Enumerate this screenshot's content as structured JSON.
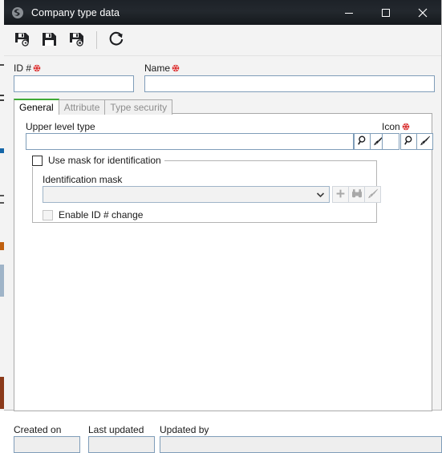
{
  "window": {
    "title": "Company type data",
    "app_icon": "globe-icon",
    "controls": {
      "minimize": "minimize-icon",
      "maximize": "maximize-icon",
      "close": "close-icon"
    }
  },
  "toolbar": {
    "buttons": [
      {
        "name": "save-and-new-button",
        "icon": "save-new-icon"
      },
      {
        "name": "save-button",
        "icon": "save-icon"
      },
      {
        "name": "save-and-close-button",
        "icon": "save-close-icon"
      },
      {
        "name": "refresh-button",
        "icon": "refresh-icon"
      }
    ]
  },
  "form": {
    "id": {
      "label": "ID #",
      "required": true,
      "value": "",
      "placeholder": ""
    },
    "name": {
      "label": "Name",
      "required": true,
      "value": "",
      "placeholder": ""
    }
  },
  "tabs": [
    {
      "label": "General",
      "active": true
    },
    {
      "label": "Attribute",
      "active": false
    },
    {
      "label": "Type security",
      "active": false
    }
  ],
  "general": {
    "upper_level_type": {
      "label": "Upper level type",
      "value": "",
      "placeholder": "",
      "search_icon": "magnifier-icon",
      "clear_icon": "brush-icon"
    },
    "icon": {
      "label": "Icon",
      "required": true,
      "value": "",
      "placeholder": "",
      "search_icon": "magnifier-icon",
      "clear_icon": "brush-icon"
    },
    "use_mask": {
      "label": "Use mask for identification",
      "checked": false,
      "enabled": true
    },
    "identification_mask": {
      "label": "Identification mask",
      "value": "",
      "placeholder": "",
      "enabled": false,
      "dropdown_icon": "chevron-down-icon",
      "add_icon": "plus-icon",
      "find_icon": "binoculars-icon",
      "clear_icon": "brush-icon"
    },
    "enable_id_change": {
      "label": "Enable ID # change",
      "checked": false,
      "enabled": false
    }
  },
  "footer": {
    "created_on": {
      "label": "Created on",
      "value": ""
    },
    "last_updated": {
      "label": "Last updated",
      "value": ""
    },
    "updated_by": {
      "label": "Updated by",
      "value": ""
    }
  },
  "colors": {
    "titlebar": "#1d2228",
    "active_tab_accent": "#3faa35",
    "required_marker": "#d92b2b",
    "field_border": "#7f9db9",
    "window_background": "#f3f3f3"
  }
}
